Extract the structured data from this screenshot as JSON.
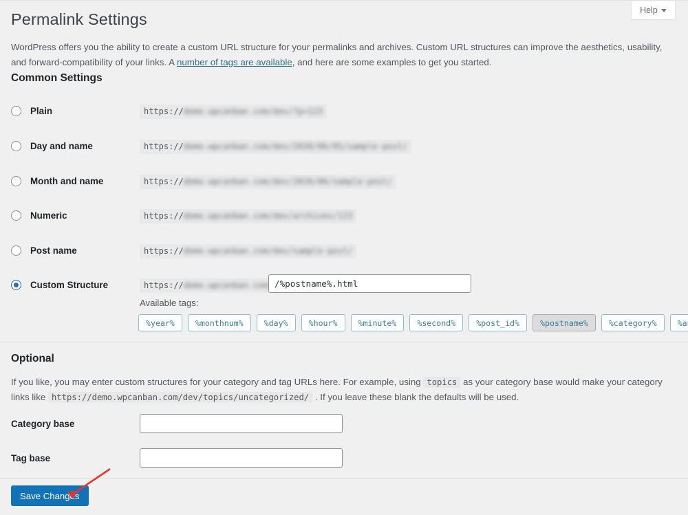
{
  "window": {
    "help_tab_label": "Help",
    "help_tab_icon": "chevron-down-icon"
  },
  "header": {
    "page_title": "Permalink Settings"
  },
  "intro": {
    "text_part_1": "WordPress offers you the ability to create a custom URL structure for your permalinks and archives. Custom URL structures can improve the aesthetics, usability, and forward-compatibility of your links. A ",
    "link_text": "number of tags are available",
    "text_part_2": ", and here are some examples to get you started."
  },
  "common_settings": {
    "title": "Common Settings",
    "options": [
      {
        "label": "Plain",
        "selected": false,
        "url_prefix": "https://",
        "url_rest": "demo.wpcanban.com/dev/?p=123"
      },
      {
        "label": "Day and name",
        "selected": false,
        "url_prefix": "https://",
        "url_rest": "demo.wpcanban.com/dev/2020/06/05/sample-post/"
      },
      {
        "label": "Month and name",
        "selected": false,
        "url_prefix": "https://",
        "url_rest": "demo.wpcanban.com/dev/2020/06/sample-post/"
      },
      {
        "label": "Numeric",
        "selected": false,
        "url_prefix": "https://",
        "url_rest": "demo.wpcanban.com/dev/archives/123"
      },
      {
        "label": "Post name",
        "selected": false,
        "url_prefix": "https://",
        "url_rest": "demo.wpcanban.com/dev/sample-post/"
      },
      {
        "label": "Custom Structure",
        "selected": true,
        "url_prefix": "https://",
        "url_rest": "demo.wpcanban.com/dev"
      }
    ],
    "custom_structure_value": "/%postname%.html",
    "available_tags_label": "Available tags:",
    "tags": [
      {
        "label": "%year%",
        "in_use": false
      },
      {
        "label": "%monthnum%",
        "in_use": false
      },
      {
        "label": "%day%",
        "in_use": false
      },
      {
        "label": "%hour%",
        "in_use": false
      },
      {
        "label": "%minute%",
        "in_use": false
      },
      {
        "label": "%second%",
        "in_use": false
      },
      {
        "label": "%post_id%",
        "in_use": false
      },
      {
        "label": "%postname%",
        "in_use": true
      },
      {
        "label": "%category%",
        "in_use": false
      },
      {
        "label": "%author%",
        "in_use": false
      }
    ]
  },
  "optional": {
    "title": "Optional",
    "desc_part_1": "If you like, you may enter custom structures for your category and tag URLs here. For example, using ",
    "desc_code_1": "topics",
    "desc_part_2": " as your category base would make your category links like ",
    "desc_code_2": "https://demo.wpcanban.com/dev/topics/uncategorized/",
    "desc_part_3": " . If you leave these blank the defaults will be used.",
    "category_base_label": "Category base",
    "category_base_value": "",
    "category_base_placeholder": "",
    "tag_base_label": "Tag base",
    "tag_base_value": "",
    "tag_base_placeholder": ""
  },
  "footer": {
    "save_label": "Save Changes"
  },
  "annotation": {
    "arrow_color": "#e8342a",
    "arrow_target": "save-changes-button"
  },
  "colors": {
    "page_background": "#f0f0f1",
    "primary_button": "#1272b5",
    "link": "#2e6d86",
    "radio_selected": "#2271b1",
    "tag_border": "#8fbdcc",
    "tag_text": "#3a7c92"
  }
}
